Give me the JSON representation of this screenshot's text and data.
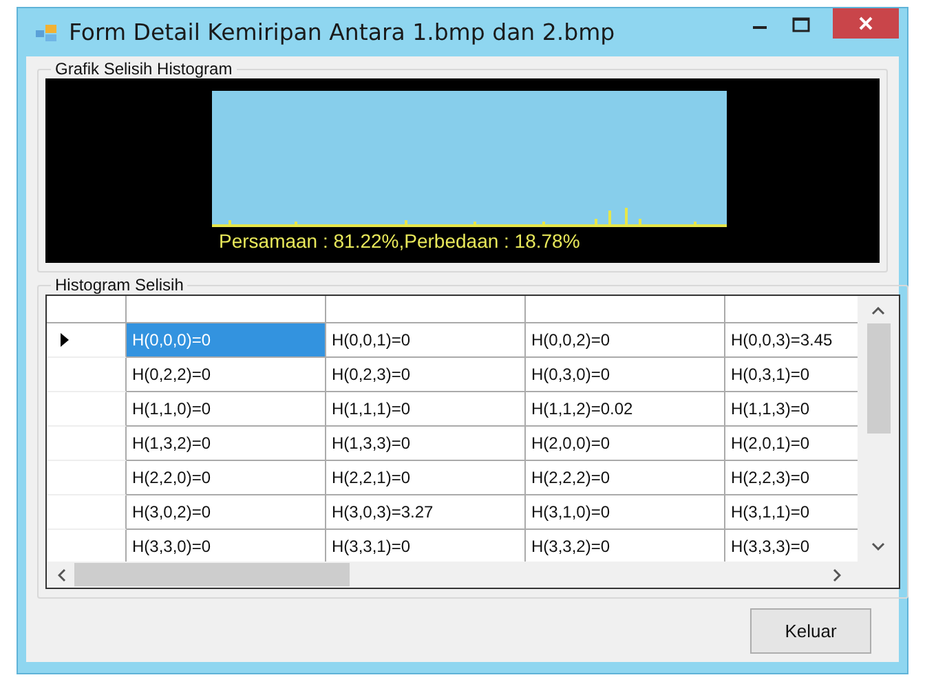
{
  "window": {
    "title": "Form Detail Kemiripan Antara 1.bmp dan 2.bmp"
  },
  "chart_group": {
    "title": "Grafik Selisih Histogram",
    "caption": "Persamaan : 81.22%,Perbedaan : 18.78%"
  },
  "table_group": {
    "title": "Histogram Selisih"
  },
  "table": {
    "rows": [
      {
        "current": true,
        "cells": [
          {
            "text": "H(0,0,0)=0",
            "selected": true
          },
          {
            "text": "H(0,0,1)=0",
            "selected": false
          },
          {
            "text": "H(0,0,2)=0",
            "selected": false
          },
          {
            "text": "H(0,0,3)=3.45",
            "selected": false
          }
        ]
      },
      {
        "current": false,
        "cells": [
          {
            "text": "H(0,2,2)=0",
            "selected": false
          },
          {
            "text": "H(0,2,3)=0",
            "selected": false
          },
          {
            "text": "H(0,3,0)=0",
            "selected": false
          },
          {
            "text": "H(0,3,1)=0",
            "selected": false
          }
        ]
      },
      {
        "current": false,
        "cells": [
          {
            "text": "H(1,1,0)=0",
            "selected": false
          },
          {
            "text": "H(1,1,1)=0",
            "selected": false
          },
          {
            "text": "H(1,1,2)=0.02",
            "selected": false
          },
          {
            "text": "H(1,1,3)=0",
            "selected": false
          }
        ]
      },
      {
        "current": false,
        "cells": [
          {
            "text": "H(1,3,2)=0",
            "selected": false
          },
          {
            "text": "H(1,3,3)=0",
            "selected": false
          },
          {
            "text": "H(2,0,0)=0",
            "selected": false
          },
          {
            "text": "H(2,0,1)=0",
            "selected": false
          }
        ]
      },
      {
        "current": false,
        "cells": [
          {
            "text": "H(2,2,0)=0",
            "selected": false
          },
          {
            "text": "H(2,2,1)=0",
            "selected": false
          },
          {
            "text": "H(2,2,2)=0",
            "selected": false
          },
          {
            "text": "H(2,2,3)=0",
            "selected": false
          }
        ]
      },
      {
        "current": false,
        "cells": [
          {
            "text": "H(3,0,2)=0",
            "selected": false
          },
          {
            "text": "H(3,0,3)=3.27",
            "selected": false
          },
          {
            "text": "H(3,1,0)=0",
            "selected": false
          },
          {
            "text": "H(3,1,1)=0",
            "selected": false
          }
        ]
      },
      {
        "current": false,
        "cells": [
          {
            "text": "H(3,3,0)=0",
            "selected": false
          },
          {
            "text": "H(3,3,1)=0",
            "selected": false
          },
          {
            "text": "H(3,3,2)=0",
            "selected": false
          },
          {
            "text": "H(3,3,3)=0",
            "selected": false
          }
        ]
      }
    ]
  },
  "buttons": [
    {
      "label": "Keluar"
    }
  ]
}
